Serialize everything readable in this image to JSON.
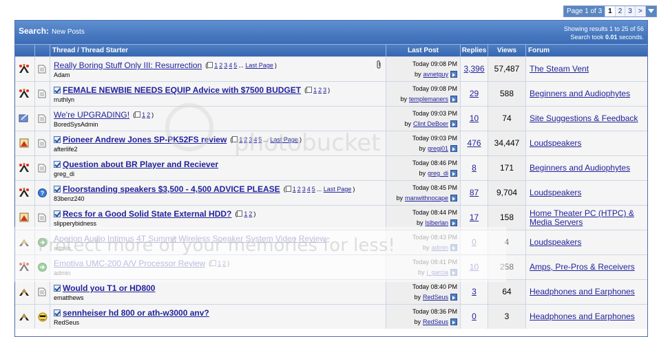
{
  "pagination": {
    "label": "Page 1 of 3",
    "pages": [
      "1",
      "2",
      "3",
      ">"
    ],
    "current": "1"
  },
  "header": {
    "search_label": "Search:",
    "search_sub": "New Posts",
    "results_line1": "Showing results 1 to 25 of 56",
    "results_line2_pre": "Search took ",
    "results_time": "0.01",
    "results_line2_post": " seconds."
  },
  "columns": {
    "thread": "Thread / Thread Starter",
    "last_post": "Last Post",
    "replies": "Replies",
    "views": "Views",
    "forum": "Forum"
  },
  "threads": [
    {
      "title": "Really Boring Stuff Only III: Resurrection",
      "bold": false,
      "checked": false,
      "pages": [
        "1",
        "2",
        "3",
        "4",
        "5"
      ],
      "last_page": "Last Page",
      "starter": "Adam",
      "time": "Today 09:08 PM",
      "by": "avnetguy",
      "replies": "3,396",
      "views": "57,487",
      "forum": "The Steam Vent",
      "forum2": "",
      "status_icon": "hot-thread-icon",
      "post_icon": "doc-icon",
      "attach": true,
      "faded": false
    },
    {
      "title": "FEMALE NEWBIE NEEDS EQUIP Advice with $7500 BUDGET",
      "bold": true,
      "checked": true,
      "pages": [
        "1",
        "2",
        "3"
      ],
      "last_page": "",
      "starter": "rruthlyn",
      "time": "Today 09:08 PM",
      "by": "templemaners",
      "replies": "29",
      "views": "588",
      "forum": "Beginners and Audiophytes",
      "forum2": "",
      "status_icon": "hot-thread-icon",
      "post_icon": "doc-icon",
      "attach": false,
      "faded": false
    },
    {
      "title": "We're UPGRADING!",
      "bold": false,
      "checked": false,
      "pages": [
        "1",
        "2"
      ],
      "last_page": "",
      "starter": "BoredSysAdmin",
      "time": "Today 09:03 PM",
      "by": "Clint DeBoer",
      "replies": "10",
      "views": "74",
      "forum": "Site Suggestions & Feedback",
      "forum2": "",
      "status_icon": "new-thread-icon",
      "post_icon": "doc-icon",
      "attach": false,
      "faded": false
    },
    {
      "title": "Pioneer Andrew Jones SP-PK52FS review",
      "bold": true,
      "checked": true,
      "pages": [
        "1",
        "2",
        "3",
        "4",
        "5"
      ],
      "last_page": "Last Page",
      "starter": "afterlife2",
      "time": "Today 09:03 PM",
      "by": "gregj01",
      "replies": "476",
      "views": "34,447",
      "forum": "Loudspeakers",
      "forum2": "",
      "status_icon": "hot-posted-icon",
      "post_icon": "doc-icon",
      "attach": false,
      "faded": false
    },
    {
      "title": "Question about BR Player and Reciever",
      "bold": true,
      "checked": true,
      "pages": [],
      "last_page": "",
      "starter": "greg_di",
      "time": "Today 08:46 PM",
      "by": "greg_di",
      "replies": "8",
      "views": "171",
      "forum": "Beginners and Audiophytes",
      "forum2": "",
      "status_icon": "hot-thread-icon",
      "post_icon": "doc-icon",
      "attach": false,
      "faded": false
    },
    {
      "title": "Floorstanding speakers $3,500 - 4,500 ADVICE PLEASE",
      "bold": true,
      "checked": true,
      "pages": [
        "1",
        "2",
        "3",
        "4",
        "5"
      ],
      "last_page": "Last Page",
      "starter": "83benz240",
      "time": "Today 08:45 PM",
      "by": "manwithnocape",
      "replies": "87",
      "views": "9,704",
      "forum": "Loudspeakers",
      "forum2": "",
      "status_icon": "hot-thread-icon",
      "post_icon": "question-icon",
      "attach": false,
      "faded": false
    },
    {
      "title": "Recs for a Good Solid State External HDD?",
      "bold": true,
      "checked": true,
      "pages": [
        "1",
        "2"
      ],
      "last_page": "",
      "starter": "slipperybidness",
      "time": "Today 08:44 PM",
      "by": "lslberlan",
      "replies": "17",
      "views": "158",
      "forum": "Home Theater PC (HTPC) &",
      "forum2": "Media Servers",
      "status_icon": "hot-posted-icon",
      "post_icon": "doc-icon",
      "attach": false,
      "faded": false
    },
    {
      "title": "Aperion Audio Intimus 4T Summit Wireless Speaker System Video Review",
      "bold": false,
      "checked": false,
      "pages": [],
      "last_page": "",
      "starter": "admin",
      "time": "Today 08:43 PM",
      "by": "admin",
      "replies": "0",
      "views": "4",
      "forum": "Loudspeakers",
      "forum2": "",
      "status_icon": "thread-icon",
      "post_icon": "arrow-icon",
      "attach": false,
      "faded": true
    },
    {
      "title": "Emotiva UMC-200 A/V Processor Review",
      "bold": false,
      "checked": false,
      "pages": [
        "1",
        "2"
      ],
      "last_page": "",
      "starter": "admin",
      "time": "Today 08:41 PM",
      "by": "j_garcia",
      "replies": "10",
      "views": "258",
      "forum": "Amps, Pre-Pros & Receivers",
      "forum2": "",
      "status_icon": "hot-thread-icon",
      "post_icon": "arrow-icon",
      "attach": false,
      "faded": true
    },
    {
      "title": "Would you T1 or HD800",
      "bold": true,
      "checked": true,
      "pages": [],
      "last_page": "",
      "starter": "ematthews",
      "time": "Today 08:40 PM",
      "by": "RedSeus",
      "replies": "3",
      "views": "64",
      "forum": "Headphones and Earphones",
      "forum2": "",
      "status_icon": "thread-icon",
      "post_icon": "doc-icon",
      "attach": false,
      "faded": false
    },
    {
      "title": "sennheiser hd 800 or ath-w3000 anv?",
      "bold": true,
      "checked": true,
      "pages": [],
      "last_page": "",
      "starter": "RedSeus",
      "time": "Today 08:36 PM",
      "by": "RedSeus",
      "replies": "0",
      "views": "3",
      "forum": "Headphones and Earphones",
      "forum2": "",
      "status_icon": "thread-icon",
      "post_icon": "cool-icon",
      "attach": false,
      "faded": false
    }
  ],
  "watermark": {
    "brand": "photobucket",
    "tagline": "Protect more of your memories for less!"
  }
}
